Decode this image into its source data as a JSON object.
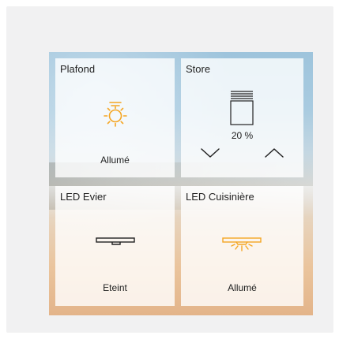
{
  "accent_color": "#f5a623",
  "tiles": [
    {
      "title": "Plafond",
      "status": "Allumé",
      "icon": "ceiling-light-on-icon"
    },
    {
      "title": "Store",
      "position": "20 %",
      "icon": "blind-icon",
      "down_icon": "chevron-down-icon",
      "up_icon": "chevron-up-icon"
    },
    {
      "title": "LED Evier",
      "status": "Eteint",
      "icon": "led-strip-off-icon"
    },
    {
      "title": "LED Cuisinière",
      "status": "Allumé",
      "icon": "led-strip-on-icon"
    }
  ]
}
